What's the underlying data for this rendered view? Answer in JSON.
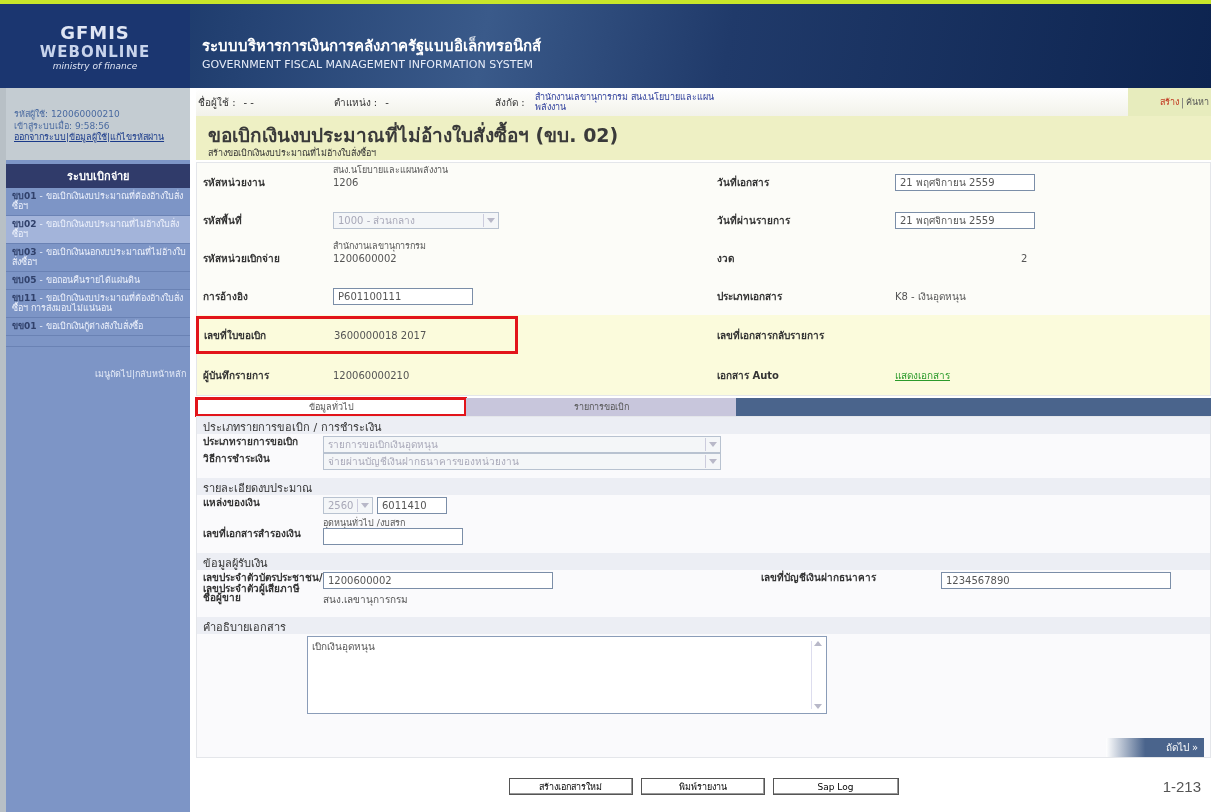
{
  "header": {
    "logo": {
      "line1": "GFMIS",
      "line2": "WEBONLINE",
      "line3": "ministry of finance"
    },
    "title_th": "ระบบบริหารการเงินการคลังภาครัฐแบบอิเล็กทรอนิกส์",
    "title_en": "GOVERNMENT FISCAL MANAGEMENT INFORMATION SYSTEM"
  },
  "sidebar": {
    "user_id": "รหัสผู้ใช้: 120060000210",
    "login_time": "เข้าสู่ระบบเมื่อ: 9:58:56",
    "links": [
      "ออกจากระบบ",
      "ข้อมูลผู้ใช้",
      "แก้ไขรหัสผ่าน"
    ],
    "link_separator": "|",
    "menu_title": "ระบบเบิกจ่าย",
    "items": [
      {
        "label": "**ขบ01** - ขอเบิกเงินงบประมาณที่ต้องอ้างใบสั่งซื้อฯ",
        "selected": false
      },
      {
        "label": "**ขบ02** - ขอเบิกเงินงบประมาณที่ไม่อ้างใบสั่งซื้อฯ",
        "selected": true
      },
      {
        "label": "**ขบ03** - ขอเบิกเงินนอกงบประมาณที่ไม่อ้างใบสั่งซื้อฯ",
        "selected": false
      },
      {
        "label": "**ขบ05** - ขอถอนคืนรายได้แผ่นดิน",
        "selected": false
      },
      {
        "label": "**ขบ11** - ขอเบิกเงินงบประมาณที่ต้องอ้างใบสั่งซื้อฯ การส่งมอบไม่แน่นอน",
        "selected": false
      },
      {
        "label": "**ขข01** - ขอเบิกเงินกู้ต่างสังใบสั่งซื้อ",
        "selected": false
      }
    ],
    "footer_links": [
      "เมนูถัดไป",
      "กลับหน้าหลัก"
    ],
    "footer_separator": "|"
  },
  "info_bar": {
    "user_label": "ชื่อผู้ใช้ :",
    "user_value": "- -",
    "position_label": "ตำแหน่ง :",
    "position_value": "-",
    "dept_label": "สังกัด :",
    "dept_value": "สำนักงานเลขานุการกรม สนง.นโยบายและแผนพลังงาน",
    "actions": [
      "สร้าง",
      "ค้นหา"
    ],
    "action_separator": "|"
  },
  "page": {
    "title": "ขอเบิกเงินงบประมาณที่ไม่อ้างใบสั่งซื้อฯ (ขบ. 02)",
    "subtitle": "สร้างขอเบิกเงินงบประมาณที่ไม่อ้างใบสั่งซื้อฯ"
  },
  "header_rows": [
    {
      "highlighted": false,
      "tint": false,
      "left": {
        "label": "รหัสหน่วยงาน",
        "kind": "text",
        "value": "1206",
        "sub": "สนง.นโยบายและแผนพลังงาน"
      },
      "right": {
        "label": "วันที่เอกสาร",
        "kind": "input",
        "value": "21 พฤศจิกายน 2559"
      }
    },
    {
      "highlighted": false,
      "tint": false,
      "left": {
        "label": "รหัสพื้นที่",
        "kind": "select",
        "value": "1000 - ส่วนกลาง",
        "disabled": true
      },
      "right": {
        "label": "วันที่ผ่านรายการ",
        "kind": "input",
        "value": "21 พฤศจิกายน 2559"
      }
    },
    {
      "highlighted": false,
      "tint": false,
      "left": {
        "label": "รหัสหน่วยเบิกจ่าย",
        "kind": "text",
        "value": "1200600002",
        "sub": "สำนักงานเลขานุการกรม"
      },
      "right": {
        "label": "งวด",
        "kind": "center",
        "value": "2"
      }
    },
    {
      "highlighted": false,
      "tint": false,
      "left": {
        "label": "การอ้างอิง",
        "kind": "input",
        "value": "P601100111"
      },
      "right": {
        "label": "ประเภทเอกสาร",
        "kind": "text",
        "value": "K8 - เงินอุดหนุน"
      }
    },
    {
      "highlighted": true,
      "tint": true,
      "left": {
        "label": "เลขที่ใบขอเบิก",
        "kind": "text",
        "value": "3600000018   2017"
      },
      "right": {
        "label": "เลขที่เอกสารกลับรายการ",
        "kind": "text"
      }
    },
    {
      "highlighted": false,
      "tint": true,
      "left": {
        "label": "ผู้บันทึกรายการ",
        "kind": "text",
        "value": "120060000210"
      },
      "right": {
        "label": "เอกสาร Auto",
        "kind": "link",
        "value": "แสดงเอกสาร"
      }
    }
  ],
  "tabs": [
    {
      "label": "ข้อมูลทั่วไป",
      "selected": true,
      "highlighted": true
    },
    {
      "label": "รายการขอเบิก",
      "selected": false,
      "highlighted": false
    }
  ],
  "sections": [
    {
      "title": "ประเภทรายการขอเบิก / การชำระเงิน",
      "rows": [
        {
          "label": "ประเภทรายการขอเบิก",
          "fields": [
            {
              "kind": "select",
              "value": "รายการขอเบิกเงินอุดหนุน",
              "disabled": true
            }
          ]
        },
        {
          "label": "วิธีการชำระเงิน",
          "fields": [
            {
              "kind": "select",
              "value": "จ่ายผ่านบัญชีเงินฝากธนาคารของหน่วยงาน",
              "disabled": true
            }
          ]
        }
      ]
    },
    {
      "title": "รายละเอียดงบประมาณ",
      "rows": [
        {
          "label": "แหล่งของเงิน",
          "fields": [
            {
              "kind": "select",
              "value": "2560",
              "disabled": true
            },
            {
              "kind": "input",
              "value": "6011410"
            }
          ],
          "sub": "อุดหนุนทั่วไป /งบสรก"
        },
        {
          "label": "เลขที่เอกสารสำรองเงิน",
          "fields": [
            {
              "kind": "input"
            }
          ]
        }
      ]
    },
    {
      "title": "ข้อมูลผู้รับเงิน",
      "rows": [
        {
          "label": "เลขประจำตัวบัตรประชาชน/ เลขประจำตัวผู้เสียภาษี",
          "fields": [
            {
              "kind": "input",
              "value": "1200600002"
            }
          ],
          "right": {
            "label": "เลขที่บัญชีเงินฝากธนาคาร",
            "value": "1234567890"
          }
        },
        {
          "label": "ชื่อผู้ขาย",
          "fields": [
            {
              "kind": "text",
              "value": "สนง.เลขานุการกรม"
            }
          ]
        }
      ]
    }
  ],
  "description": {
    "title": "คำอธิบายเอกสาร",
    "value": "เบิกเงินอุดหนุน"
  },
  "next_button": "ถัดไป »",
  "buttons": [
    "สร้างเอกสารใหม่",
    "พิมพ์รายงาน",
    "Sap Log"
  ],
  "page_number": "1-213"
}
